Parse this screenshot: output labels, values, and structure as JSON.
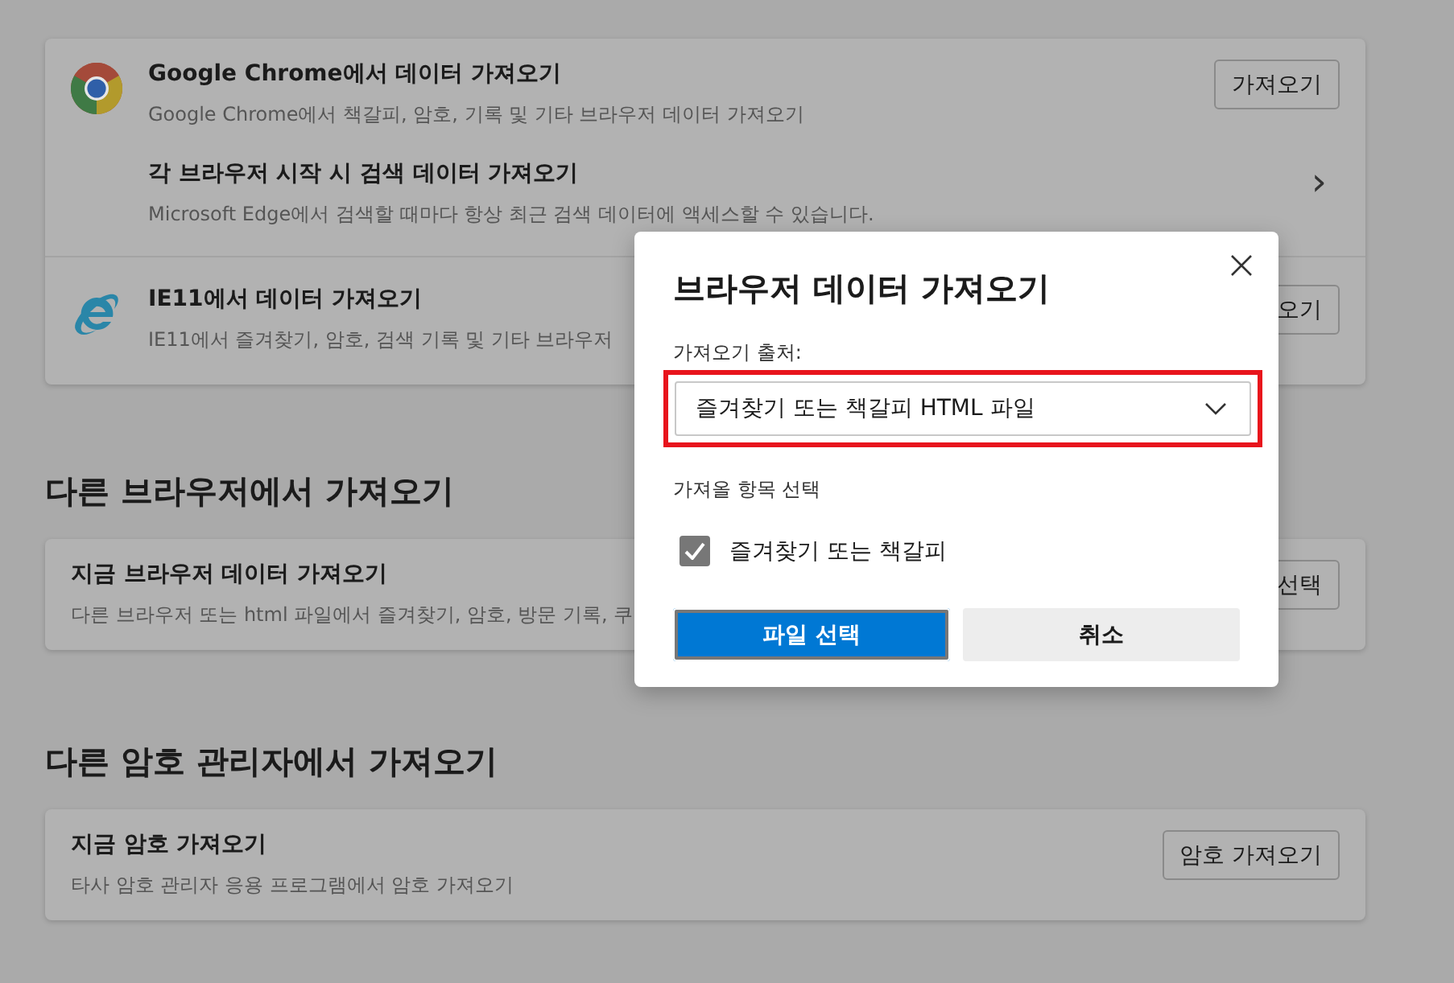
{
  "import_card": {
    "rows": [
      {
        "kind": "chrome",
        "title": "Google Chrome에서 데이터 가져오기",
        "description": "Google Chrome에서 책갈피, 암호, 기록 및 기타 브라우저 데이터 가져오기",
        "button": "가져오기"
      },
      {
        "kind": "link",
        "title": "각 브라우저 시작 시 검색 데이터 가져오기",
        "description": "Microsoft Edge에서 검색할 때마다 항상 최근 검색 데이터에 액세스할 수 있습니다.",
        "chevron": "›"
      },
      {
        "kind": "ie",
        "title": "IE11에서 데이터 가져오기",
        "description": "IE11에서 즐겨찾기, 암호, 검색 기록 및 기타 브라우저",
        "button": "오기"
      }
    ]
  },
  "sections": [
    {
      "heading": "다른 브라우저에서 가져오기",
      "title": "지금 브라우저 데이터 가져오기",
      "description": "다른 브라우저 또는 html 파일에서 즐겨찾기, 암호, 방문 기록, 쿠",
      "button": "선택"
    },
    {
      "heading": "다른 암호 관리자에서 가져오기",
      "title": "지금 암호 가져오기",
      "description": "타사 암호 관리자 응용 프로그램에서 암호 가져오기",
      "button": "암호 가져오기"
    }
  ],
  "dialog": {
    "title": "브라우저 데이터 가져오기",
    "source_label": "가져오기 출처:",
    "source_value": "즐겨찾기 또는 책갈피 HTML 파일",
    "source_highlighted": true,
    "items_label": "가져올 항목 선택",
    "items": [
      {
        "label": "즐겨찾기 또는 책갈피",
        "checked": true
      }
    ],
    "primary_button": "파일 선택",
    "cancel_button": "취소"
  }
}
